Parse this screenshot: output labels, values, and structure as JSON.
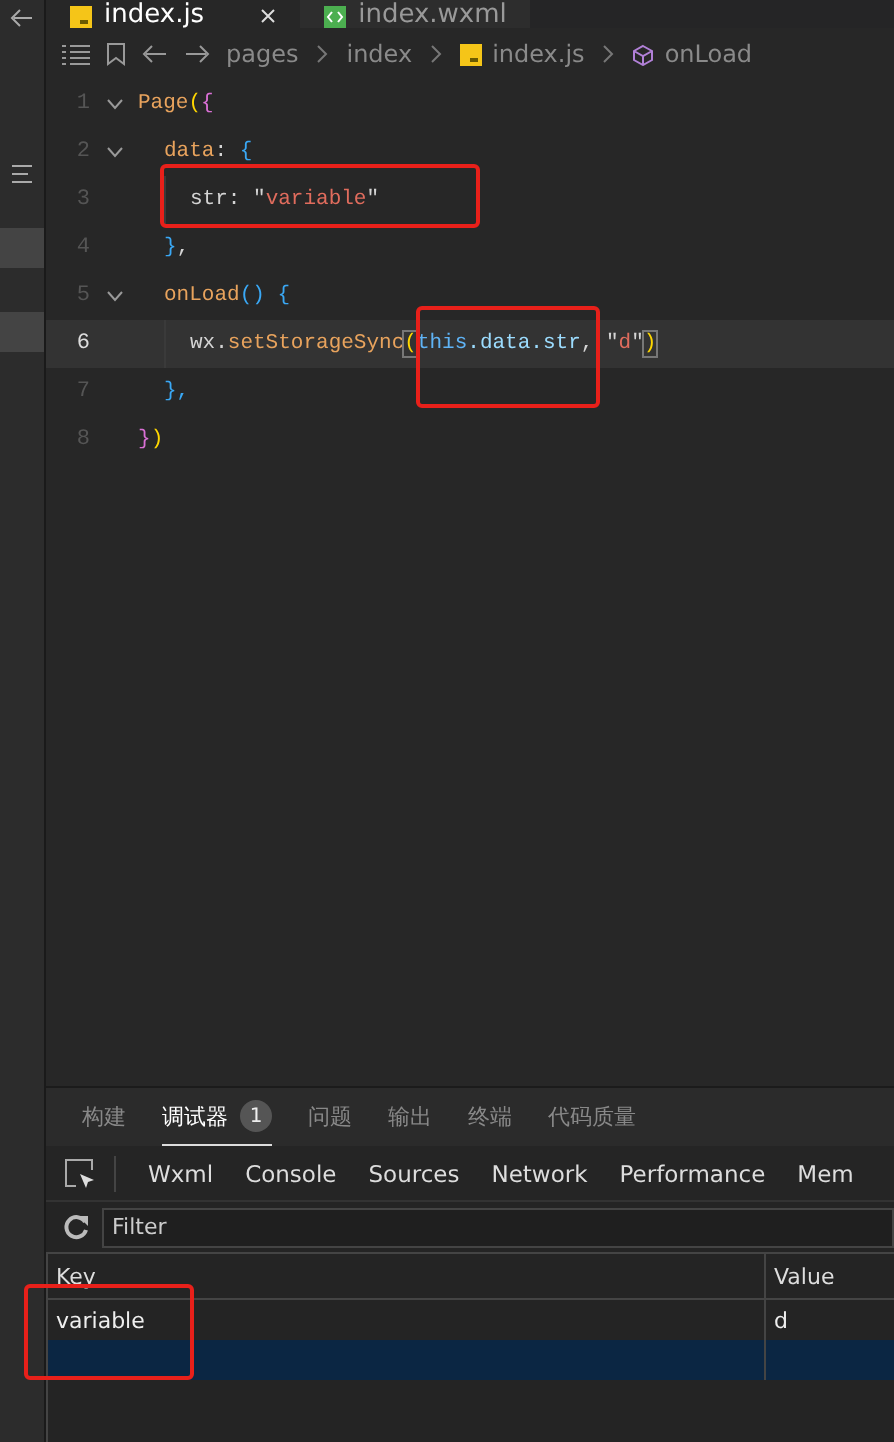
{
  "editor_tabs": [
    {
      "label": "index.js",
      "selected": true,
      "closable": true
    },
    {
      "label": "index.wxml",
      "selected": false,
      "closable": false
    }
  ],
  "breadcrumb": [
    {
      "label": "pages"
    },
    {
      "label": "index"
    },
    {
      "label": "index.js"
    },
    {
      "label": "onLoad"
    }
  ],
  "code_lines": [
    {
      "number": "1",
      "foldable": true,
      "current": false,
      "tokens": [
        {
          "text": "Page",
          "kind": "fn"
        },
        {
          "text": "(",
          "kind": "b1"
        },
        {
          "text": "{",
          "kind": "b2"
        }
      ]
    },
    {
      "number": "2",
      "foldable": true,
      "current": false,
      "tokens": [
        {
          "text": "  data",
          "kind": "fn"
        },
        {
          "text": ": ",
          "kind": "plain"
        },
        {
          "text": "{",
          "kind": "b3"
        }
      ]
    },
    {
      "number": "3",
      "foldable": false,
      "current": false,
      "tokens": [
        {
          "text": "    str: ",
          "kind": "plain"
        },
        {
          "text": "\"",
          "kind": "plain"
        },
        {
          "text": "variable",
          "kind": "str"
        },
        {
          "text": "\"",
          "kind": "plain"
        }
      ]
    },
    {
      "number": "4",
      "foldable": false,
      "current": false,
      "tokens": [
        {
          "text": "  }",
          "kind": "b3"
        },
        {
          "text": ",",
          "kind": "plain"
        }
      ]
    },
    {
      "number": "5",
      "foldable": true,
      "current": false,
      "tokens": [
        {
          "text": "  onLoad",
          "kind": "fn"
        },
        {
          "text": "() {",
          "kind": "b3"
        }
      ]
    },
    {
      "number": "6",
      "foldable": false,
      "current": true,
      "tokens": [
        {
          "text": "    wx.",
          "kind": "plain"
        },
        {
          "text": "setStorageSync",
          "kind": "fn"
        },
        {
          "text": "(",
          "kind": "b1m"
        },
        {
          "text": "this",
          "kind": "kw"
        },
        {
          "text": ".data.str",
          "kind": "prop"
        },
        {
          "text": ", ",
          "kind": "plain"
        },
        {
          "text": "\"",
          "kind": "plain"
        },
        {
          "text": "d",
          "kind": "str"
        },
        {
          "text": "\"",
          "kind": "plain"
        },
        {
          "text": ")",
          "kind": "b1m"
        }
      ]
    },
    {
      "number": "7",
      "foldable": false,
      "current": false,
      "tokens": [
        {
          "text": "  },",
          "kind": "b3"
        }
      ]
    },
    {
      "number": "8",
      "foldable": false,
      "current": false,
      "tokens": [
        {
          "text": "}",
          "kind": "b2"
        },
        {
          "text": ")",
          "kind": "b1"
        }
      ]
    }
  ],
  "panel_tabs": [
    {
      "label": "构建",
      "selected": false
    },
    {
      "label": "调试器",
      "selected": true,
      "badge": "1"
    },
    {
      "label": "问题",
      "selected": false
    },
    {
      "label": "输出",
      "selected": false
    },
    {
      "label": "终端",
      "selected": false
    },
    {
      "label": "代码质量",
      "selected": false
    }
  ],
  "devtools_tabs": [
    {
      "label": "Wxml",
      "selected": false
    },
    {
      "label": "Console",
      "selected": false
    },
    {
      "label": "Sources",
      "selected": false
    },
    {
      "label": "Network",
      "selected": false
    },
    {
      "label": "Performance",
      "selected": false
    },
    {
      "label": "Mem",
      "selected": false
    }
  ],
  "filter": {
    "placeholder": "Filter"
  },
  "storage_table": {
    "columns": [
      "Key",
      "Value"
    ],
    "rows": [
      {
        "key": "variable",
        "value": "d",
        "selected": false
      },
      {
        "selected": true
      }
    ]
  }
}
